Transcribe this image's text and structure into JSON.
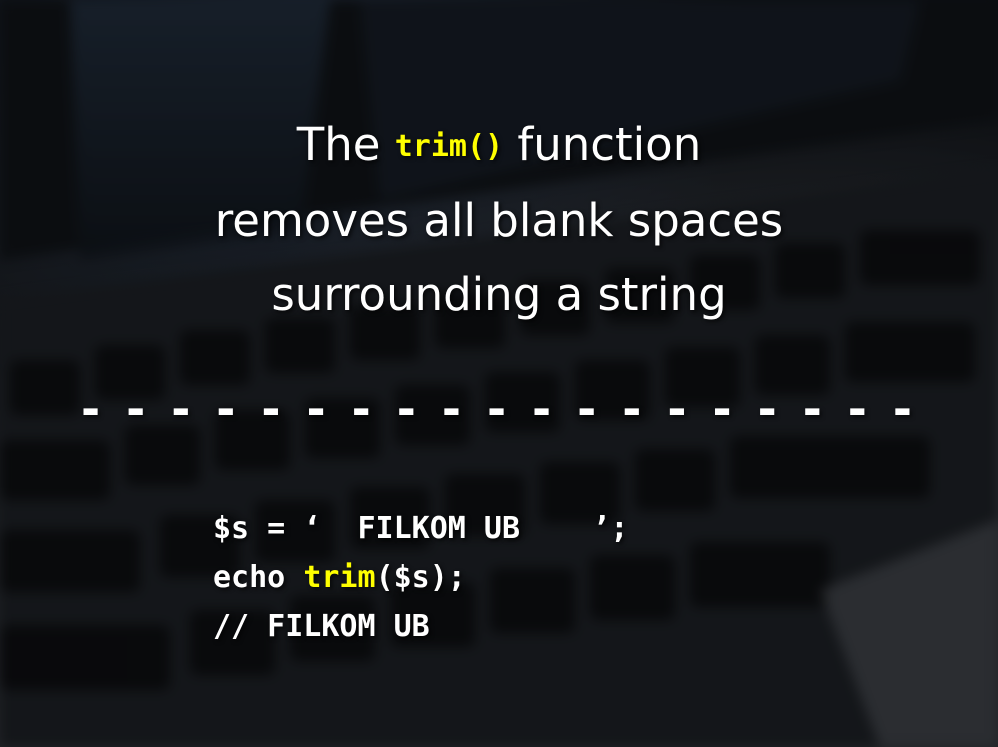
{
  "slide": {
    "title": {
      "line1_before": "The ",
      "function_name": "trim()",
      "line1_after": " function",
      "line2": "removes all blank spaces",
      "line3": "surrounding a string"
    },
    "separator": "- - - - - - - - - - - - - - - - - - -",
    "code": {
      "line1": "$s = ‘  FILKOM UB    ’;",
      "line2_before": "echo ",
      "line2_function": "trim",
      "line2_after": "($s);",
      "line3": "// FILKOM UB"
    }
  },
  "colors": {
    "text": "#ffffff",
    "highlight": "#ffff00"
  }
}
